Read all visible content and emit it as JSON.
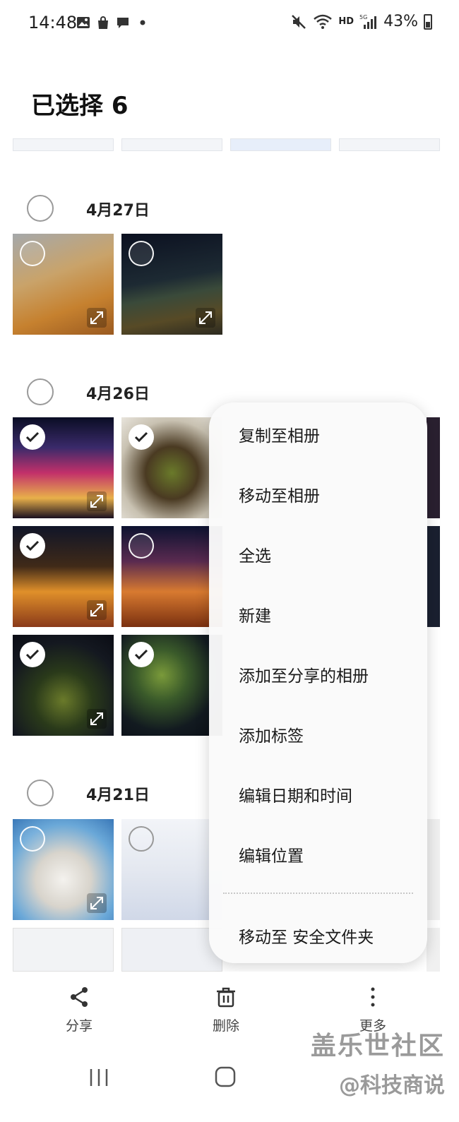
{
  "status_bar": {
    "time": "14:48",
    "network": "HD",
    "battery": "43%"
  },
  "header": {
    "title": "已选择 6"
  },
  "sections": [
    {
      "date": "4月27日"
    },
    {
      "date": "4月26日"
    },
    {
      "date": "4月21日"
    }
  ],
  "menu": {
    "items": [
      "复制至相册",
      "移动至相册",
      "全选",
      "新建",
      "添加至分享的相册",
      "添加标签",
      "编辑日期和时间",
      "编辑位置",
      "移动至 安全文件夹"
    ]
  },
  "bottom_actions": {
    "share": "分享",
    "delete": "删除",
    "more": "更多"
  },
  "watermark": {
    "line1": "盖乐世社区",
    "line2": "@科技商说"
  },
  "icons": [
    "image-icon",
    "bag-icon",
    "chat-icon",
    "mute-icon",
    "wifi-icon",
    "signal-icon",
    "battery-icon",
    "share-icon",
    "trash-icon",
    "more-icon",
    "recents-icon",
    "home-icon",
    "expand-icon",
    "check-icon"
  ],
  "colors": {
    "background": "#ffffff",
    "menu_background": "#fafafa",
    "text": "#1a1a1a"
  }
}
